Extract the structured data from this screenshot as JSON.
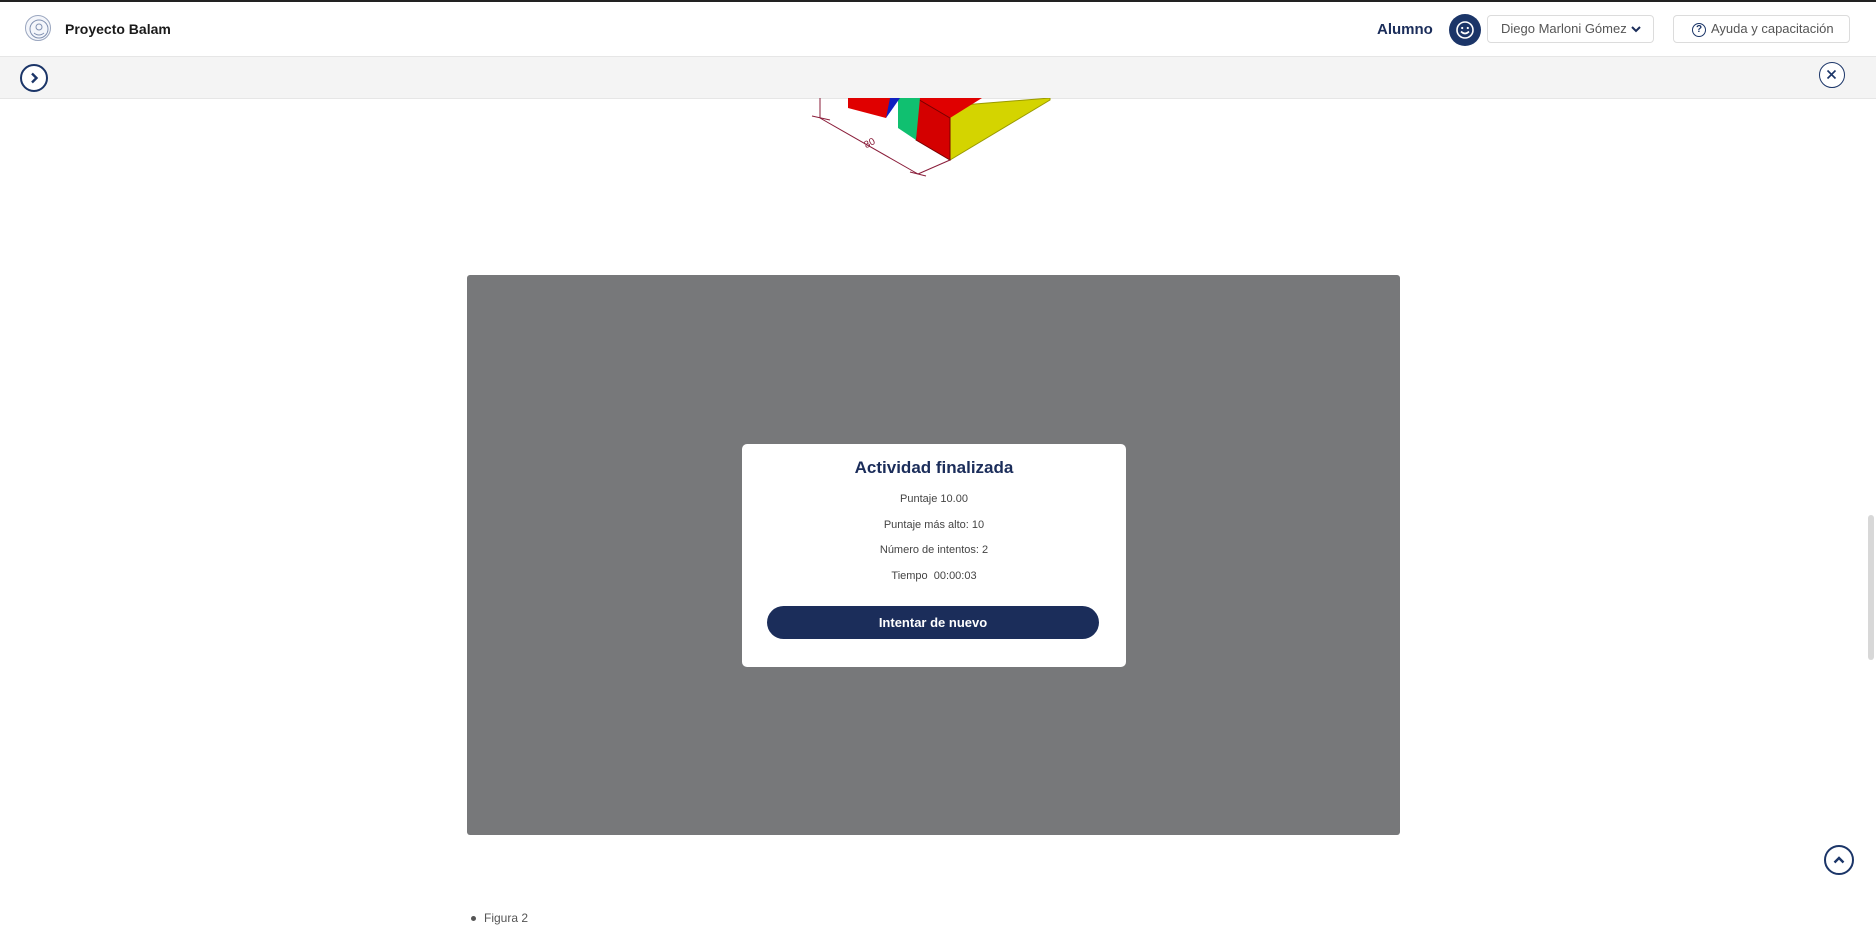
{
  "header": {
    "brand": "Proyecto Balam",
    "role": "Alumno",
    "user_name": "Diego Marloni Gómez",
    "help_label": "Ayuda y capacitación"
  },
  "icons": {
    "logo": "university-seal-icon",
    "avatar": "smiley-face-icon",
    "user_dropdown": "chevron-down-icon",
    "help": "question-circle-icon",
    "expand": "chevron-right-icon",
    "close": "close-icon",
    "scroll_top": "chevron-up-icon"
  },
  "figure": {
    "dimension_label": "80"
  },
  "result": {
    "title": "Actividad finalizada",
    "score": "Puntaje 10.00",
    "high_score": "Puntaje más alto: 10",
    "attempts": "Número de intentos: 2",
    "time": "Tiempo  00:00:03",
    "retry_label": "Intentar de nuevo"
  },
  "content": {
    "figure_caption": "Figura 2"
  },
  "colors": {
    "brand_navy": "#1b2d5a",
    "overlay_gray": "#77787a",
    "figure_red": "#e00000",
    "figure_yellow": "#d4d400",
    "figure_green": "#10c070",
    "figure_blue": "#1020c0"
  }
}
